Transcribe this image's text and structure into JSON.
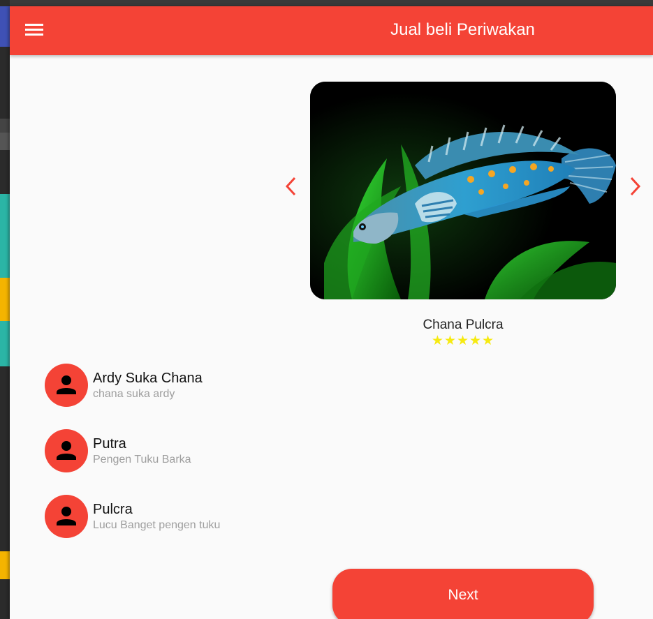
{
  "appbar": {
    "title": "Jual beli Periwakan",
    "menu_icon": "menu-icon"
  },
  "carousel": {
    "fish_name": "Chana Pulcra",
    "rating": 5,
    "stars_text": "★★★★★",
    "prev_icon": "chevron-left-icon",
    "next_icon": "chevron-right-icon",
    "image_description": "photo of snakehead fish"
  },
  "comments": [
    {
      "name": "Ardy Suka Chana",
      "text": "chana suka ardy"
    },
    {
      "name": "Putra",
      "text": "Pengen Tuku Barka"
    },
    {
      "name": "Pulcra",
      "text": "Lucu Banget pengen tuku"
    }
  ],
  "next_button": {
    "label": "Next"
  },
  "colors": {
    "primary": "#f44336",
    "star": "#f6ea10",
    "background": "#fafafa"
  }
}
